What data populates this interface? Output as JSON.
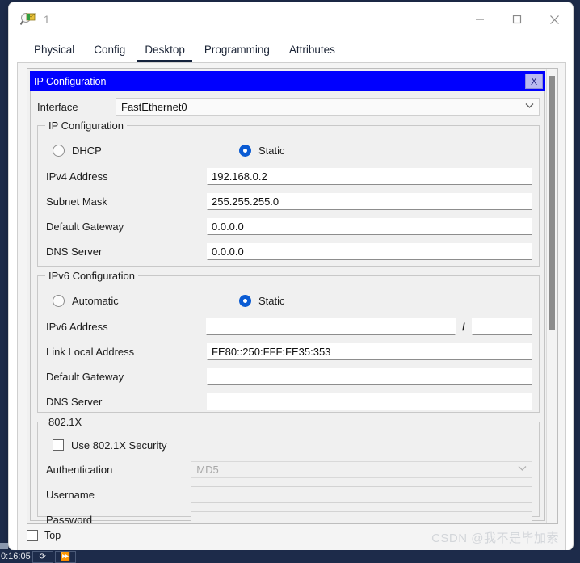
{
  "window": {
    "title": "1",
    "icon": "packet-tracer-device-icon",
    "controls": {
      "minimize": "—",
      "maximize": "□",
      "close": "✕"
    }
  },
  "tabs": [
    {
      "label": "Physical",
      "active": false
    },
    {
      "label": "Config",
      "active": false
    },
    {
      "label": "Desktop",
      "active": true
    },
    {
      "label": "Programming",
      "active": false
    },
    {
      "label": "Attributes",
      "active": false
    }
  ],
  "dialog": {
    "title": "IP Configuration",
    "close_label": "X"
  },
  "interface": {
    "label": "Interface",
    "value": "FastEthernet0",
    "chevron": "⌄"
  },
  "ipv4": {
    "group_title": "IP Configuration",
    "dhcp_label": "DHCP",
    "static_label": "Static",
    "mode": "static",
    "fields": [
      {
        "label": "IPv4 Address",
        "value": "192.168.0.2"
      },
      {
        "label": "Subnet Mask",
        "value": "255.255.255.0"
      },
      {
        "label": "Default Gateway",
        "value": "0.0.0.0"
      },
      {
        "label": "DNS Server",
        "value": "0.0.0.0"
      }
    ]
  },
  "ipv6": {
    "group_title": "IPv6 Configuration",
    "automatic_label": "Automatic",
    "static_label": "Static",
    "mode": "static",
    "address_label": "IPv6 Address",
    "address_value": "",
    "prefix_separator": "/",
    "prefix_value": "",
    "fields": [
      {
        "label": "Link Local Address",
        "value": "FE80::250:FFF:FE35:353"
      },
      {
        "label": "Default Gateway",
        "value": ""
      },
      {
        "label": "DNS Server",
        "value": ""
      }
    ]
  },
  "dot1x": {
    "group_title": "802.1X",
    "use_security_label": "Use 802.1X Security",
    "use_security_checked": false,
    "authentication_label": "Authentication",
    "authentication_value": "MD5",
    "authentication_chevron": "⌄",
    "username_label": "Username",
    "username_value": "",
    "password_label": "Password",
    "password_value": ""
  },
  "bottom": {
    "top_checkbox_label": "Top",
    "top_checked": false
  },
  "watermark": "CSDN @我不是毕加索",
  "taskbar": {
    "time": "0:16:05",
    "buttons": [
      "⟳",
      "⏩"
    ]
  },
  "colors": {
    "dialog_title_bg": "#0000FF",
    "radio_selected": "#0A5BD3",
    "tab_active_underline": "#14223C",
    "taskbar_bg": "#1D2B4A",
    "panel_bg": "#F0F0F0"
  }
}
